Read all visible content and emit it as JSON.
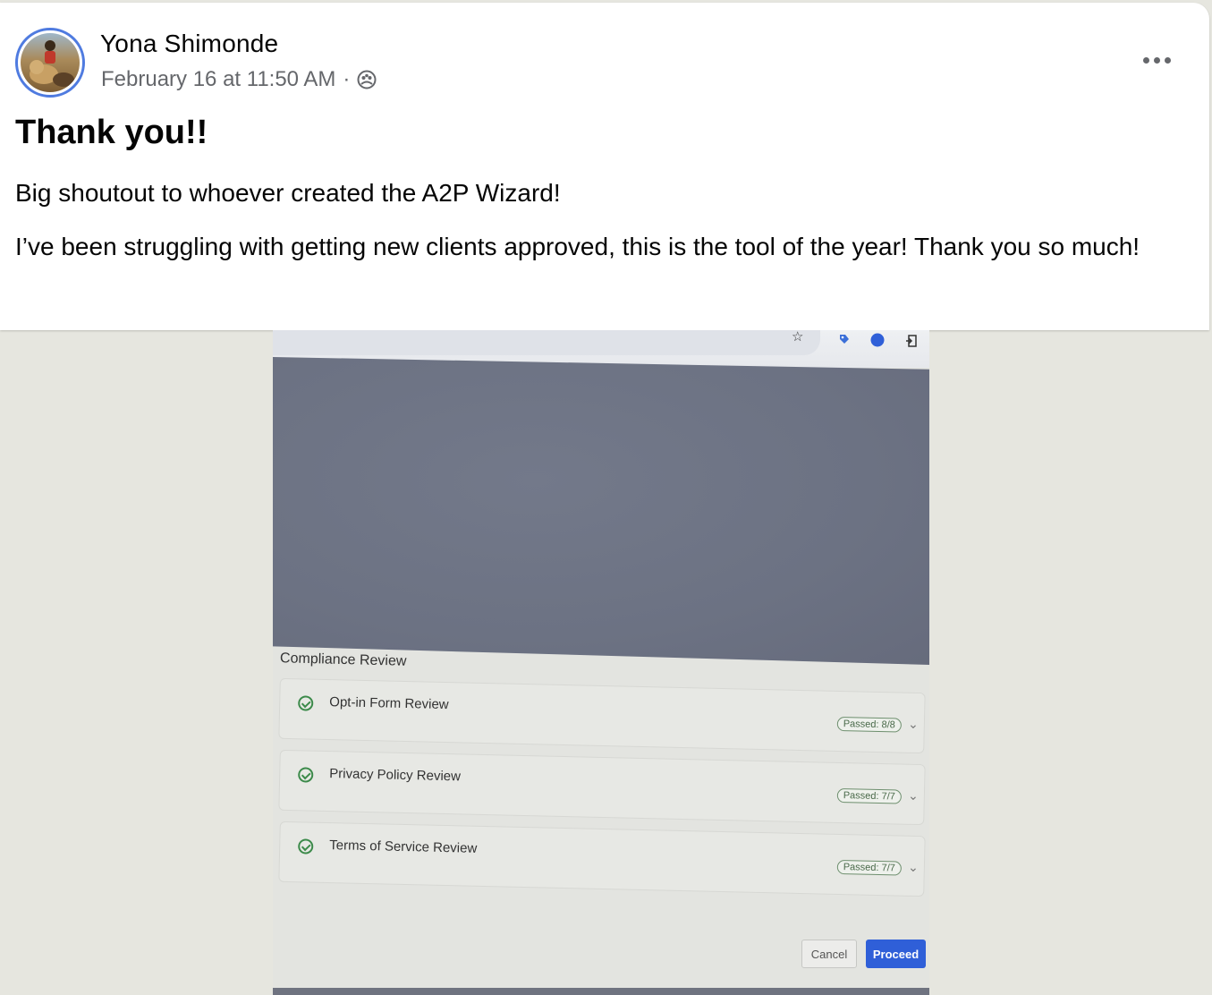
{
  "post": {
    "author": "Yona Shimonde",
    "timestamp": "February 16 at 11:50 AM",
    "separator": "·",
    "audience_icon": "group-icon",
    "more_icon": "more-options-icon",
    "title": "Thank you!!",
    "paragraphs": [
      "Big shoutout to whoever created the A2P Wizard!",
      "I’ve been struggling with getting new clients approved, this is the tool of the year! Thank you so much!"
    ]
  },
  "photo": {
    "browser_icons": [
      "star-icon",
      "tag-icon",
      "profile-icon",
      "extension-icon"
    ],
    "compliance_title": "Compliance Review",
    "reviews": [
      {
        "label": "Opt-in Form Review",
        "badge": "Passed: 8/8"
      },
      {
        "label": "Privacy Policy Review",
        "badge": "Passed: 7/7"
      },
      {
        "label": "Terms of Service Review",
        "badge": "Passed: 7/7"
      }
    ],
    "cancel_label": "Cancel",
    "proceed_label": "Proceed"
  },
  "colors": {
    "accent_blue": "#2f5fd8",
    "avatar_ring": "#4f7be0",
    "secondary_text": "#65676b",
    "background": "#e6e6df"
  }
}
